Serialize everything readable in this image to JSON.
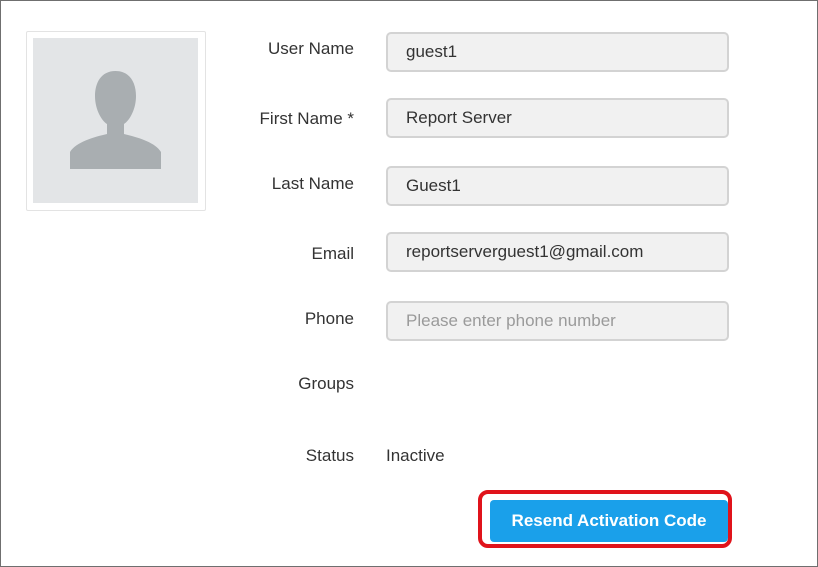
{
  "avatar": {
    "icon": "user-silhouette-icon"
  },
  "form": {
    "user_name": {
      "label": "User Name",
      "value": "guest1"
    },
    "first_name": {
      "label": "First Name *",
      "value": "Report Server"
    },
    "last_name": {
      "label": "Last Name",
      "value": "Guest1"
    },
    "email": {
      "label": "Email",
      "value": "reportserverguest1@gmail.com"
    },
    "phone": {
      "label": "Phone",
      "value": "",
      "placeholder": "Please enter phone number"
    },
    "groups": {
      "label": "Groups"
    },
    "status": {
      "label": "Status",
      "value": "Inactive"
    }
  },
  "actions": {
    "resend_label": "Resend Activation Code"
  },
  "colors": {
    "button": "#1aa0ea",
    "highlight": "#e0131b",
    "field_bg": "#f1f1f1",
    "field_border": "#d3d3d3",
    "avatar_bg": "#e3e5e7",
    "avatar_figure": "#a9aeb1"
  }
}
